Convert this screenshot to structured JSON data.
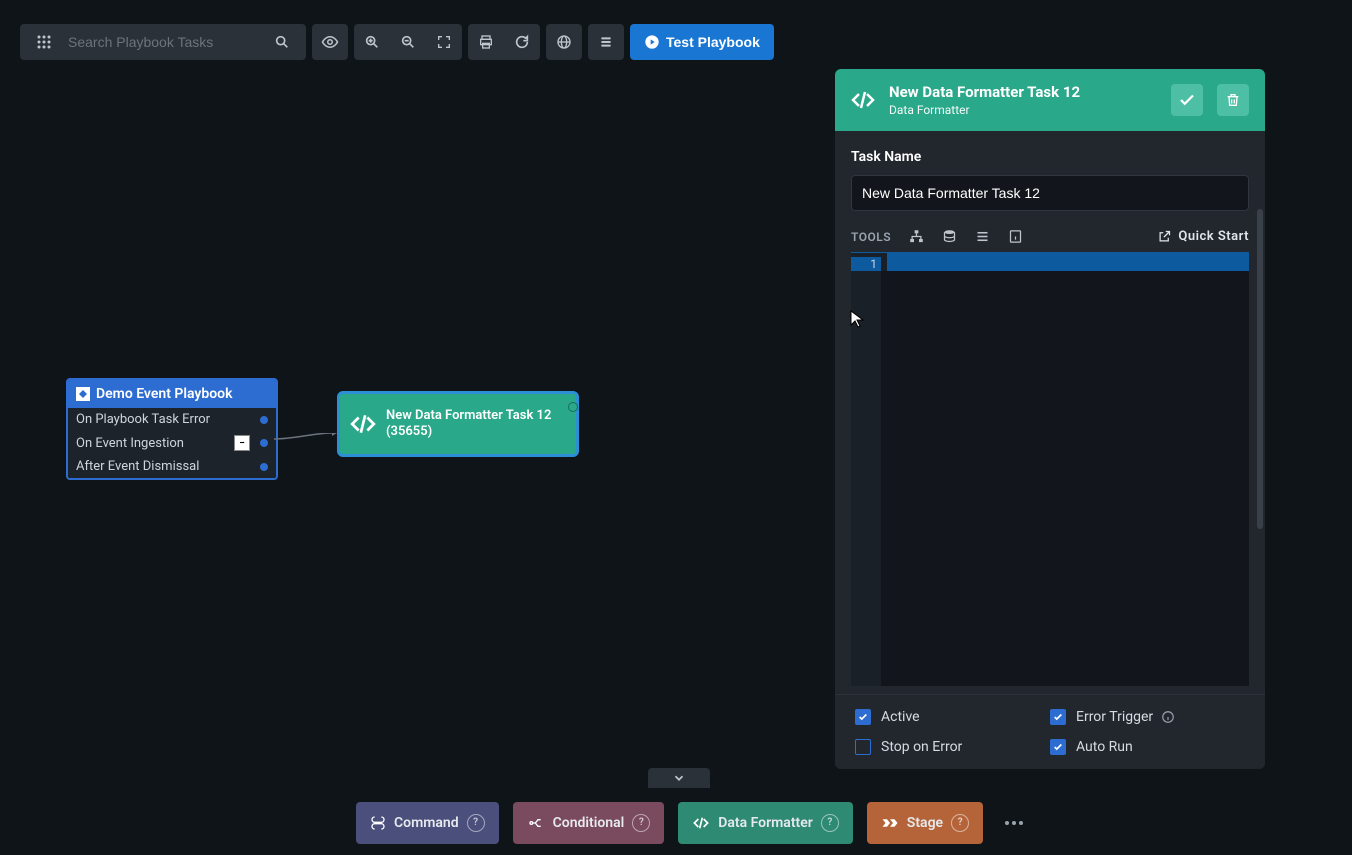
{
  "toolbar": {
    "search_placeholder": "Search Playbook Tasks",
    "test_label": "Test Playbook"
  },
  "playbook": {
    "title": "Demo Event Playbook",
    "rows": [
      {
        "label": "On Playbook Task Error"
      },
      {
        "label": "On Event Ingestion"
      },
      {
        "label": "After Event Dismissal"
      }
    ]
  },
  "task_node": {
    "label": "New Data Formatter Task 12 (35655)"
  },
  "panel": {
    "title": "New Data Formatter Task 12",
    "subtitle": "Data Formatter",
    "task_name_label": "Task Name",
    "task_name_value": "New Data Formatter Task 12",
    "tools_label": "TOOLS",
    "quick_start": "Quick Start",
    "line_no": "1",
    "checks": {
      "active": "Active",
      "stop_on_error": "Stop on Error",
      "error_trigger": "Error Trigger",
      "auto_run": "Auto Run"
    }
  },
  "bottom": {
    "command": "Command",
    "conditional": "Conditional",
    "data_formatter": "Data Formatter",
    "stage": "Stage"
  }
}
